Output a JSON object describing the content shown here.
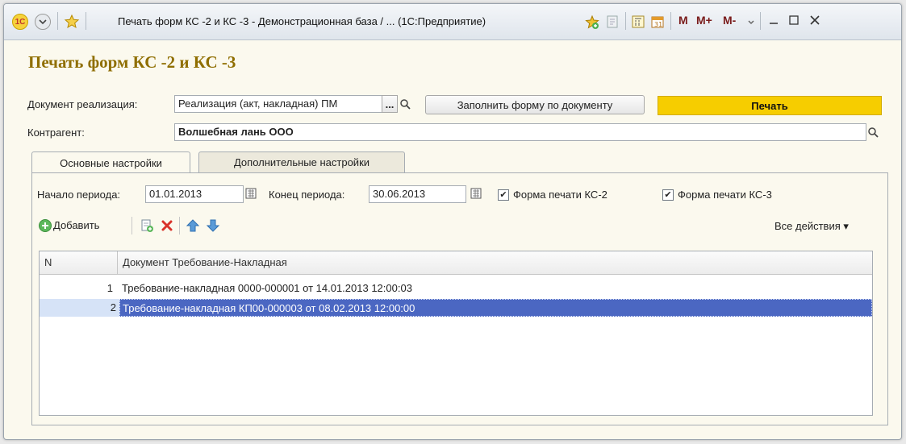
{
  "window": {
    "title": "Печать форм КС -2 и КС -3 - Демонстрационная база / ...  (1С:Предприятие)",
    "icons": [
      "1c-logo-icon",
      "menu-dropdown-icon",
      "favorites-star-icon",
      "add-favorite-icon",
      "history-icon",
      "calculator-icon",
      "calendar-icon"
    ],
    "memory_buttons": [
      "M",
      "M+",
      "M-"
    ]
  },
  "form": {
    "title": "Печать форм КС -2 и КС -3",
    "document_label": "Документ реализация:",
    "document_value": "Реализация (акт, накладная) ПМ",
    "document_more": "...",
    "fill_button": "Заполнить форму по документу",
    "print_button": "Печать",
    "counterparty_label": "Контрагент:",
    "counterparty_value": "Волшебная лань ООО"
  },
  "tabs": [
    {
      "label": "Основные настройки",
      "active": true
    },
    {
      "label": "Дополнительные настройки",
      "active": false
    }
  ],
  "settings": {
    "period_start_label": "Начало периода:",
    "period_start": "01.01.2013",
    "period_end_label": "Конец периода:",
    "period_end": "30.06.2013",
    "ks2_label": "Форма печати КС-2",
    "ks2_checked": true,
    "ks3_label": "Форма печати КС-3",
    "ks3_checked": true
  },
  "toolbar": {
    "add_label": "Добавить",
    "all_actions": "Все действия"
  },
  "table": {
    "columns": [
      "N",
      "Документ Требование-Накладная"
    ],
    "rows": [
      {
        "n": "1",
        "doc": "Требование-накладная 0000-000001 от 14.01.2013 12:00:03",
        "selected": false
      },
      {
        "n": "2",
        "doc": "Требование-накладная КП00-000003 от 08.02.2013 12:00:00",
        "selected": true
      }
    ]
  },
  "colors": {
    "title_color": "#8f6e00",
    "print_button": "#f6cd00",
    "selection": "#4b67c2",
    "background": "#fbf9ee"
  }
}
